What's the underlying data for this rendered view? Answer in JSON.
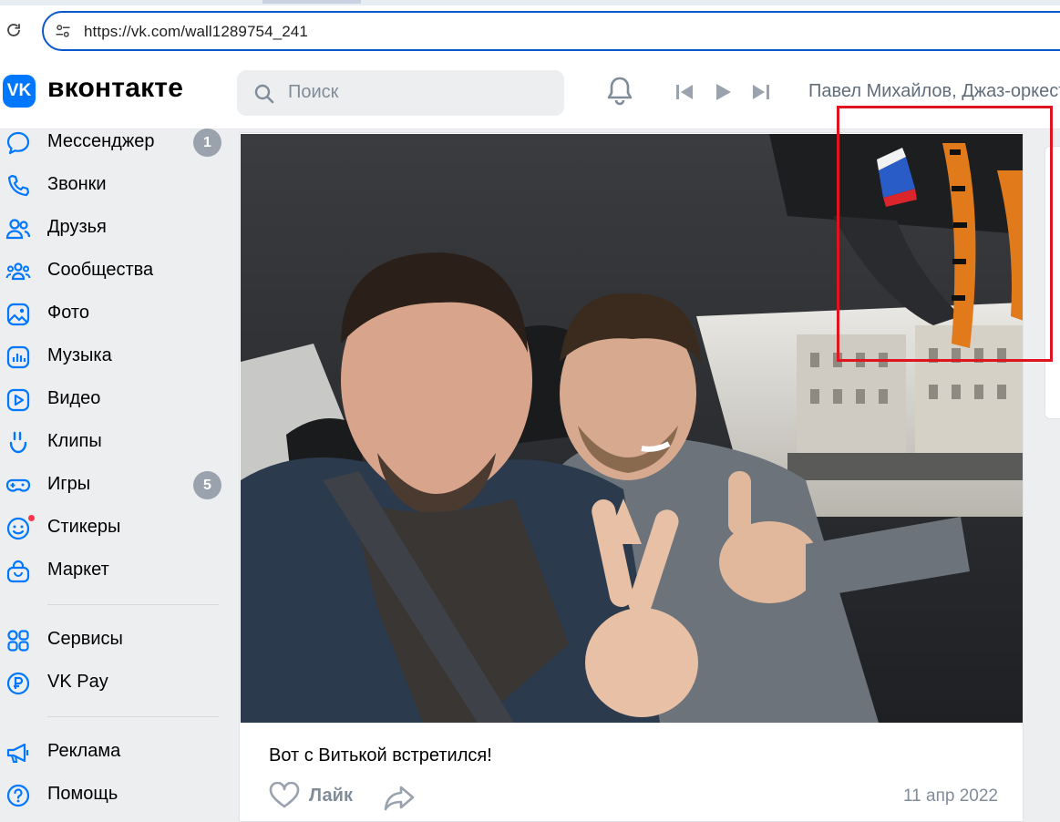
{
  "browser": {
    "url": "https://vk.com/wall1289754_241"
  },
  "header": {
    "brand": "вконтакте",
    "logo_text": "VK",
    "search_placeholder": "Поиск",
    "now_playing": "Павел Михайлов, Джаз-оркестр"
  },
  "sidebar": {
    "items": [
      {
        "label": "Мессенджер",
        "icon": "message-icon",
        "badge": "1"
      },
      {
        "label": "Звонки",
        "icon": "phone-icon"
      },
      {
        "label": "Друзья",
        "icon": "friends-icon"
      },
      {
        "label": "Сообщества",
        "icon": "communities-icon"
      },
      {
        "label": "Фото",
        "icon": "photo-icon"
      },
      {
        "label": "Музыка",
        "icon": "music-icon"
      },
      {
        "label": "Видео",
        "icon": "video-icon"
      },
      {
        "label": "Клипы",
        "icon": "clips-icon"
      },
      {
        "label": "Игры",
        "icon": "games-icon",
        "badge": "5"
      },
      {
        "label": "Стикеры",
        "icon": "stickers-icon"
      },
      {
        "label": "Маркет",
        "icon": "market-icon"
      },
      {
        "label": "Сервисы",
        "icon": "services-icon"
      },
      {
        "label": "VK Pay",
        "icon": "vkpay-icon"
      },
      {
        "label": "Реклама",
        "icon": "ads-icon"
      },
      {
        "label": "Помощь",
        "icon": "help-icon"
      }
    ]
  },
  "post": {
    "text": "Вот с Витькой встретился!",
    "like_label": "Лайк",
    "date": "11 апр 2022"
  },
  "colors": {
    "vk_blue": "#0077ff",
    "highlight_red": "#e0141e",
    "secondary_text": "#818c99"
  }
}
